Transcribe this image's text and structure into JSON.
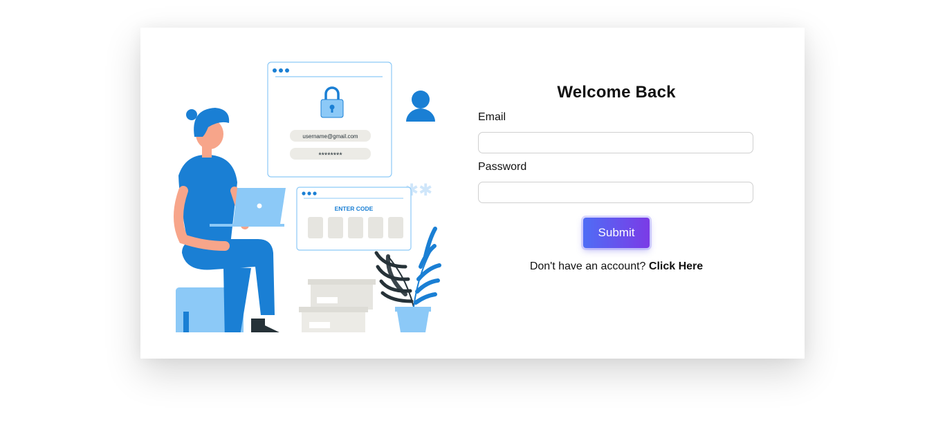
{
  "form": {
    "title": "Welcome Back",
    "email_label": "Email",
    "email_value": "",
    "password_label": "Password",
    "password_value": "",
    "submit_label": "Submit",
    "signup_prompt": "Don't have an account?",
    "signup_link": "Click Here"
  },
  "illustration": {
    "username_text": "username@gmail.com",
    "password_mask": "********",
    "code_title": "ENTER CODE",
    "colors": {
      "primary_blue": "#1a7fd4",
      "light_blue": "#8cc9f7",
      "skin": "#f7a58a",
      "dark": "#263238",
      "grey": "#e6e5e0"
    }
  },
  "colors": {
    "submit_gradient_start": "#4f6df5",
    "submit_gradient_end": "#7b3be6",
    "card_bg": "#ffffff",
    "input_border": "#cfcfcf"
  }
}
